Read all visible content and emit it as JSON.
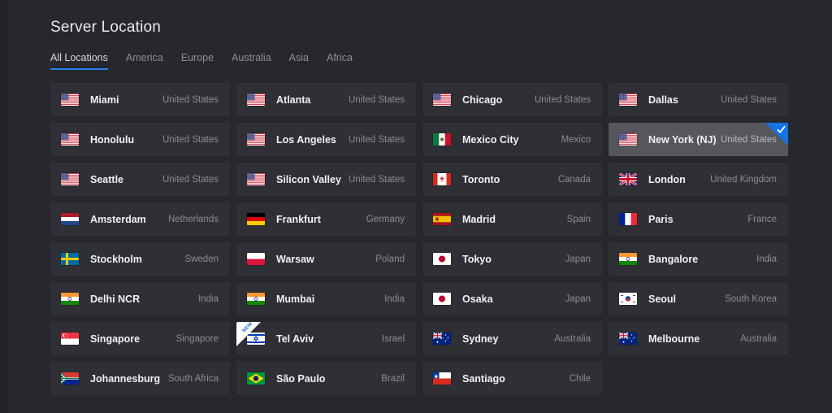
{
  "header": {
    "title": "Server Location"
  },
  "tabs": [
    {
      "label": "All Locations",
      "active": true
    },
    {
      "label": "America",
      "active": false
    },
    {
      "label": "Europe",
      "active": false
    },
    {
      "label": "Australia",
      "active": false
    },
    {
      "label": "Asia",
      "active": false
    },
    {
      "label": "Africa",
      "active": false
    }
  ],
  "colors": {
    "accent": "#2680eb",
    "selected_ribbon": "#1473e6",
    "page_bg": "#212329",
    "panel_bg": "#26282d",
    "card_bg": "#2e3036",
    "card_selected_bg": "#55575c",
    "city_text": "#f0f1f2",
    "country_text": "#8b8d93",
    "new_badge_text": "#1a62d6"
  },
  "badges": {
    "new_label": "NEW",
    "selected_icon": "check-icon"
  },
  "locations": [
    {
      "city": "Miami",
      "country": "United States",
      "flag": "us",
      "selected": false,
      "is_new": false
    },
    {
      "city": "Atlanta",
      "country": "United States",
      "flag": "us",
      "selected": false,
      "is_new": false
    },
    {
      "city": "Chicago",
      "country": "United States",
      "flag": "us",
      "selected": false,
      "is_new": false
    },
    {
      "city": "Dallas",
      "country": "United States",
      "flag": "us",
      "selected": false,
      "is_new": false
    },
    {
      "city": "Honolulu",
      "country": "United States",
      "flag": "us",
      "selected": false,
      "is_new": false
    },
    {
      "city": "Los Angeles",
      "country": "United States",
      "flag": "us",
      "selected": false,
      "is_new": false
    },
    {
      "city": "Mexico City",
      "country": "Mexico",
      "flag": "mx",
      "selected": false,
      "is_new": false
    },
    {
      "city": "New York (NJ)",
      "country": "United States",
      "flag": "us",
      "selected": true,
      "is_new": false
    },
    {
      "city": "Seattle",
      "country": "United States",
      "flag": "us",
      "selected": false,
      "is_new": false
    },
    {
      "city": "Silicon Valley",
      "country": "United States",
      "flag": "us",
      "selected": false,
      "is_new": false
    },
    {
      "city": "Toronto",
      "country": "Canada",
      "flag": "ca",
      "selected": false,
      "is_new": false
    },
    {
      "city": "London",
      "country": "United Kingdom",
      "flag": "gb",
      "selected": false,
      "is_new": false
    },
    {
      "city": "Amsterdam",
      "country": "Netherlands",
      "flag": "nl",
      "selected": false,
      "is_new": false
    },
    {
      "city": "Frankfurt",
      "country": "Germany",
      "flag": "de",
      "selected": false,
      "is_new": false
    },
    {
      "city": "Madrid",
      "country": "Spain",
      "flag": "es",
      "selected": false,
      "is_new": false
    },
    {
      "city": "Paris",
      "country": "France",
      "flag": "fr",
      "selected": false,
      "is_new": false
    },
    {
      "city": "Stockholm",
      "country": "Sweden",
      "flag": "se",
      "selected": false,
      "is_new": false
    },
    {
      "city": "Warsaw",
      "country": "Poland",
      "flag": "pl",
      "selected": false,
      "is_new": false
    },
    {
      "city": "Tokyo",
      "country": "Japan",
      "flag": "jp",
      "selected": false,
      "is_new": false
    },
    {
      "city": "Bangalore",
      "country": "India",
      "flag": "in",
      "selected": false,
      "is_new": false
    },
    {
      "city": "Delhi NCR",
      "country": "India",
      "flag": "in",
      "selected": false,
      "is_new": false
    },
    {
      "city": "Mumbai",
      "country": "India",
      "flag": "in",
      "selected": false,
      "is_new": false
    },
    {
      "city": "Osaka",
      "country": "Japan",
      "flag": "jp",
      "selected": false,
      "is_new": false
    },
    {
      "city": "Seoul",
      "country": "South Korea",
      "flag": "kr",
      "selected": false,
      "is_new": false
    },
    {
      "city": "Singapore",
      "country": "Singapore",
      "flag": "sg",
      "selected": false,
      "is_new": false
    },
    {
      "city": "Tel Aviv",
      "country": "Israel",
      "flag": "il",
      "selected": false,
      "is_new": true
    },
    {
      "city": "Sydney",
      "country": "Australia",
      "flag": "au",
      "selected": false,
      "is_new": false
    },
    {
      "city": "Melbourne",
      "country": "Australia",
      "flag": "au",
      "selected": false,
      "is_new": false
    },
    {
      "city": "Johannesburg",
      "country": "South Africa",
      "flag": "za",
      "selected": false,
      "is_new": false
    },
    {
      "city": "São Paulo",
      "country": "Brazil",
      "flag": "br",
      "selected": false,
      "is_new": false
    },
    {
      "city": "Santiago",
      "country": "Chile",
      "flag": "cl",
      "selected": false,
      "is_new": false
    }
  ]
}
